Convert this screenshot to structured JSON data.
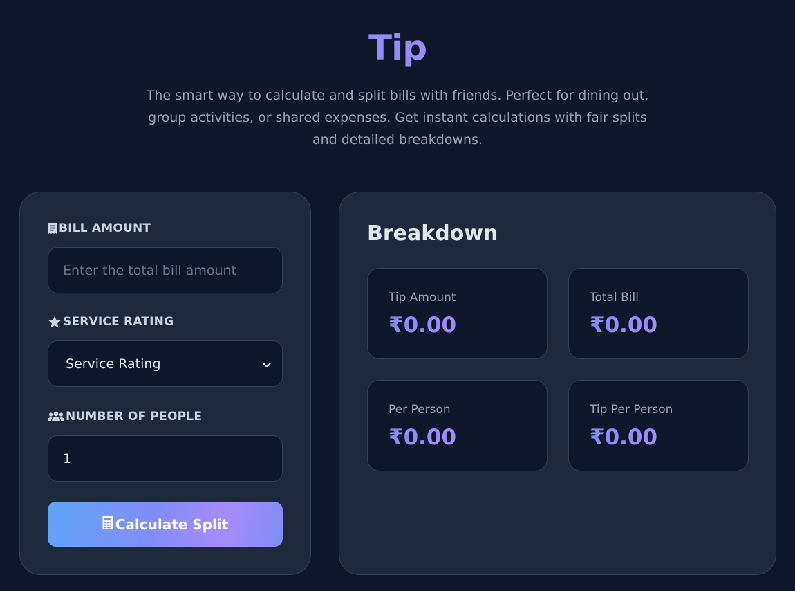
{
  "header": {
    "title": "Tip",
    "subtitle": "The smart way to calculate and split bills with friends. Perfect for dining out, group activities, or shared expenses. Get instant calculations with fair splits and detailed breakdowns."
  },
  "form": {
    "bill": {
      "label": "BILL AMOUNT",
      "icon": "receipt-icon",
      "value": "",
      "placeholder": "Enter the total bill amount"
    },
    "rating": {
      "label": "SERVICE RATING",
      "icon": "star-icon",
      "selected": "Service Rating"
    },
    "people": {
      "label": "NUMBER OF PEOPLE",
      "icon": "users-icon",
      "value": "1"
    },
    "submit": {
      "label": "Calculate Split",
      "icon": "calculator-icon"
    }
  },
  "breakdown": {
    "title": "Breakdown",
    "stats": [
      {
        "label": "Tip Amount",
        "value": "₹0.00"
      },
      {
        "label": "Total Bill",
        "value": "₹0.00"
      },
      {
        "label": "Per Person",
        "value": "₹0.00"
      },
      {
        "label": "Tip Per Person",
        "value": "₹0.00"
      }
    ]
  },
  "colors": {
    "background": "#0f172a",
    "card": "#1e293b",
    "accent": "#818cf8",
    "accent_secondary": "#a78bfa"
  }
}
